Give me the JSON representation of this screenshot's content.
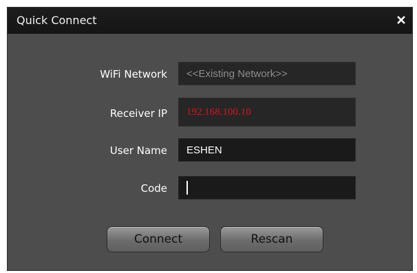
{
  "window": {
    "title": "Quick Connect",
    "close_glyph": "×"
  },
  "form": {
    "wifi": {
      "label": "WiFi Network",
      "value": "<<Existing Network>>"
    },
    "receiver_ip": {
      "label": "Receiver IP",
      "value": "192.168.100.10"
    },
    "user_name": {
      "label": "User Name",
      "value": "ESHEN"
    },
    "code": {
      "label": "Code",
      "value": ""
    }
  },
  "buttons": {
    "connect": "Connect",
    "rescan": "Rescan"
  },
  "colors": {
    "ip_value": "#e0101a",
    "dialog_bg": "#4d4d4d",
    "titlebar_bg": "#1a1a1a"
  },
  "icons": {
    "close": "close-icon"
  }
}
